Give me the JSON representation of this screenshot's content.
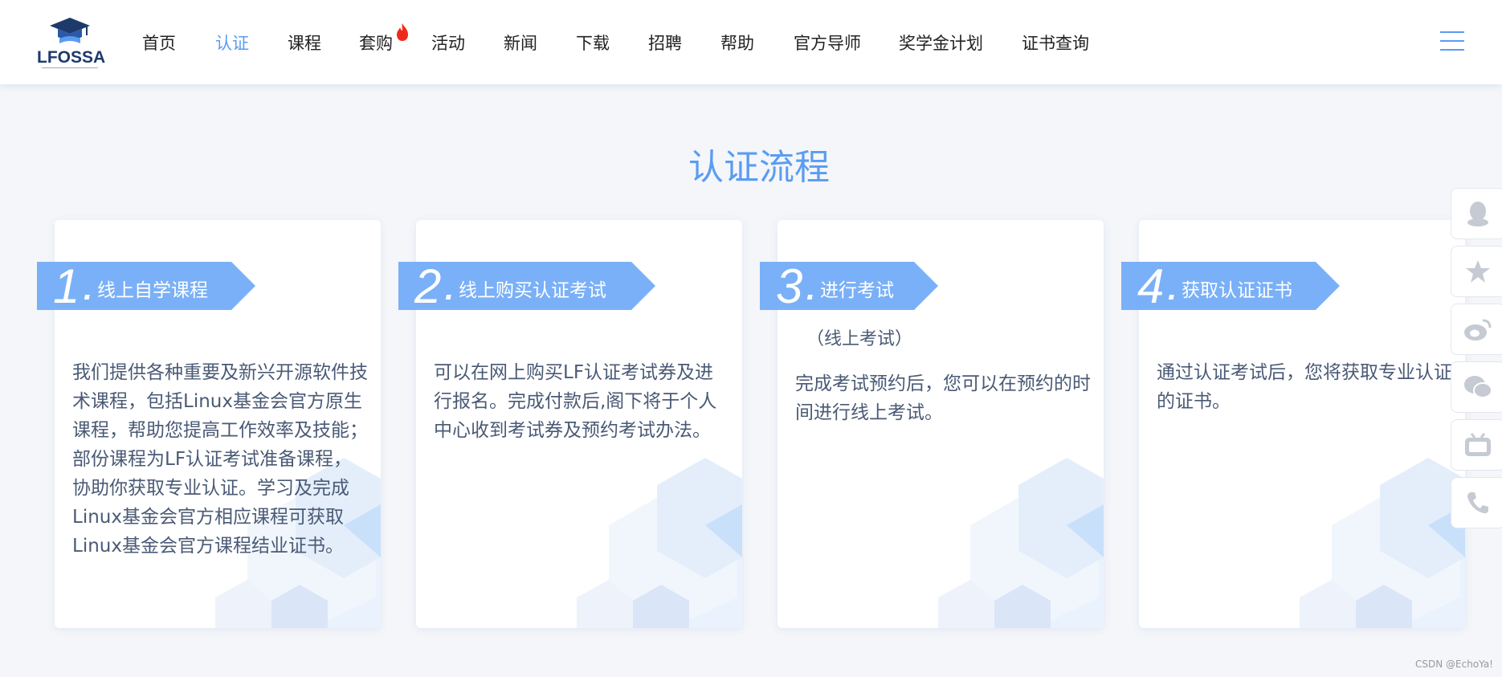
{
  "brand": {
    "logo_text": "LFOSSA"
  },
  "nav": {
    "items": [
      {
        "label": "首页",
        "active": false
      },
      {
        "label": "认证",
        "active": true
      },
      {
        "label": "课程",
        "active": false
      },
      {
        "label": "套购",
        "active": false,
        "hot": true
      },
      {
        "label": "活动",
        "active": false
      },
      {
        "label": "新闻",
        "active": false
      },
      {
        "label": "下载",
        "active": false
      },
      {
        "label": "招聘",
        "active": false
      },
      {
        "label": "帮助",
        "active": false
      },
      {
        "label": "官方导师",
        "active": false
      },
      {
        "label": "奖学金计划",
        "active": false
      },
      {
        "label": "证书查询",
        "active": false
      }
    ],
    "menu_icon": "hamburger-icon"
  },
  "section": {
    "title": "认证流程"
  },
  "steps": [
    {
      "num": "1",
      "dot": ".",
      "title": "线上自学课程",
      "note": "",
      "text": "我们提供各种重要及新兴开源软件技术课程，包括Linux基金会官方原生课程，帮助您提高工作效率及技能；部份课程为LF认证考试准备课程，协助你获取专业认证。学习及完成Linux基金会官方相应课程可获取Linux基金会官方课程结业证书。"
    },
    {
      "num": "2",
      "dot": ".",
      "title": "线上购买认证考试",
      "note": "",
      "text": "可以在网上购买LF认证考试券及进行报名。完成付款后,阁下将于个人中心收到考试券及预约考试办法。"
    },
    {
      "num": "3",
      "dot": ".",
      "title": "进行考试",
      "note": "（线上考试）",
      "text": "完成考试预约后，您可以在预约的时间进行线上考试。"
    },
    {
      "num": "4",
      "dot": ".",
      "title": "获取认证证书",
      "note": "",
      "text": "通过认证考试后，您将获取专业认证的证书。"
    }
  ],
  "sidebar": {
    "icons": [
      "qq-icon",
      "star-icon",
      "weibo-icon",
      "wechat-icon",
      "bilibili-icon",
      "phone-icon"
    ]
  },
  "watermark": "CSDN @EchoYa!",
  "colors": {
    "accent": "#5b9cf2",
    "ribbon": "#7ab0f7",
    "text": "#4a5a75",
    "background": "#f4f6f9"
  }
}
